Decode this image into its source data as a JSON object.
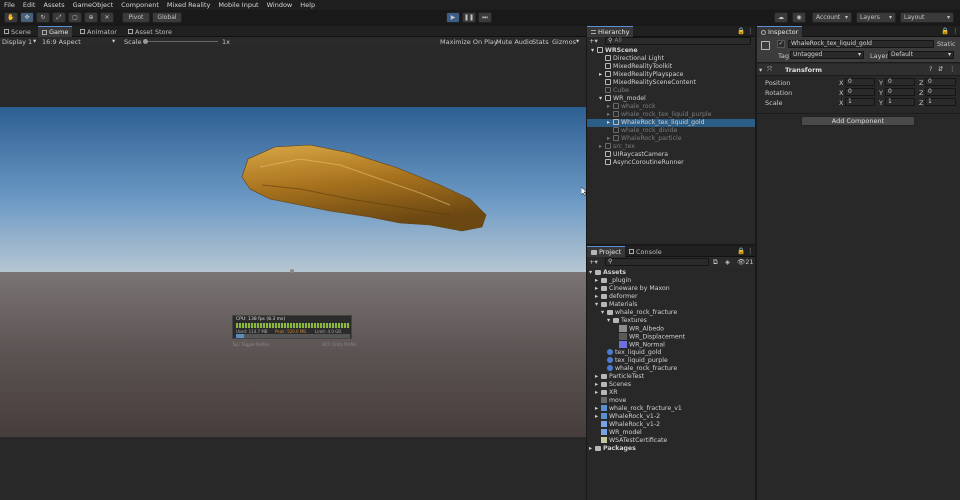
{
  "menu": [
    "File",
    "Edit",
    "Assets",
    "GameObject",
    "Component",
    "Mixed Reality",
    "Mobile Input",
    "Window",
    "Help"
  ],
  "toolbar": {
    "pivot": "Pivot",
    "global": "Global",
    "account": "Account",
    "layers": "Layers",
    "layout": "Layout"
  },
  "scene_tabs": {
    "scene": "Scene",
    "game": "Game",
    "animator": "Animator",
    "asset_store": "Asset Store"
  },
  "game_bar": {
    "display": "Display 1",
    "aspect": "16:9 Aspect",
    "scale_label": "Scale",
    "scale_value": "1x",
    "maximize": "Maximize On Play",
    "mute": "Mute Audio",
    "stats": "Stats",
    "gizmos": "Gizmos"
  },
  "overlay": {
    "cpu": "CPU: 138 fps (8.3 ms)",
    "used": "Used: 114.7 MB",
    "peak": "Peak: 520.0 MB",
    "limit": "Limit: 4.0 GB",
    "line2_left": "Tap: Toggle Profiler",
    "line2_right": "HL5: Unity Profile"
  },
  "hierarchy": {
    "title": "Hierarchy",
    "search": "All",
    "items": [
      {
        "label": "WRScene",
        "depth": 0,
        "dim": false
      },
      {
        "label": "Directional Light",
        "depth": 1,
        "dim": false
      },
      {
        "label": "MixedRealityToolkit",
        "depth": 1,
        "dim": false
      },
      {
        "label": "MixedRealityPlayspace",
        "depth": 1,
        "dim": false
      },
      {
        "label": "MixedRealitySceneContent",
        "depth": 1,
        "dim": false
      },
      {
        "label": "Cube",
        "depth": 1,
        "dim": true
      },
      {
        "label": "WR_model",
        "depth": 1,
        "dim": false
      },
      {
        "label": "whale_rock",
        "depth": 2,
        "dim": true
      },
      {
        "label": "whale_rock_tex_liquid_purple",
        "depth": 2,
        "dim": true
      },
      {
        "label": "WhaleRock_tex_liquid_gold",
        "depth": 2,
        "dim": false
      },
      {
        "label": "whale_rock_divide",
        "depth": 2,
        "dim": true
      },
      {
        "label": "WhaleRock_particle",
        "depth": 2,
        "dim": true
      },
      {
        "label": "src_tex",
        "depth": 1,
        "dim": true
      },
      {
        "label": "UIRaycastCamera",
        "depth": 1,
        "dim": false
      },
      {
        "label": "AsyncCoroutineRunner",
        "depth": 1,
        "dim": false
      }
    ]
  },
  "inspector": {
    "title": "Inspector",
    "object_name": "WhaleRock_tex_liquid_gold",
    "static": "Static",
    "tag_label": "Tag",
    "tag_value": "Untagged",
    "layer_label": "Layer",
    "layer_value": "Default",
    "transform": "Transform",
    "position": {
      "label": "Position",
      "x": "0",
      "y": "0",
      "z": "0"
    },
    "rotation": {
      "label": "Rotation",
      "x": "0",
      "y": "0",
      "z": "0"
    },
    "scale": {
      "label": "Scale",
      "x": "1",
      "y": "1",
      "z": "1"
    },
    "add_component": "Add Component"
  },
  "project": {
    "tab_project": "Project",
    "tab_console": "Console",
    "count": "21",
    "items": [
      {
        "label": "Assets",
        "depth": 0,
        "kind": "folder"
      },
      {
        "label": "_plugin",
        "depth": 1,
        "kind": "folder"
      },
      {
        "label": "Cineware by Maxon",
        "depth": 1,
        "kind": "folder"
      },
      {
        "label": "deformer",
        "depth": 1,
        "kind": "folder"
      },
      {
        "label": "Materials",
        "depth": 1,
        "kind": "folder"
      },
      {
        "label": "whale_rock_fracture",
        "depth": 2,
        "kind": "folder"
      },
      {
        "label": "Textures",
        "depth": 3,
        "kind": "folder"
      },
      {
        "label": "WR_Albedo",
        "depth": 4,
        "kind": "tex_albedo"
      },
      {
        "label": "WR_Displacement",
        "depth": 4,
        "kind": "tex_disp"
      },
      {
        "label": "WR_Normal",
        "depth": 4,
        "kind": "tex_normal"
      },
      {
        "label": "tex_liquid_gold",
        "depth": 2,
        "kind": "mat"
      },
      {
        "label": "tex_liquid_purple",
        "depth": 2,
        "kind": "mat"
      },
      {
        "label": "whale_rock_fracture",
        "depth": 2,
        "kind": "mat"
      },
      {
        "label": "ParticleTest",
        "depth": 1,
        "kind": "folder"
      },
      {
        "label": "Scenes",
        "depth": 1,
        "kind": "folder"
      },
      {
        "label": "XR",
        "depth": 1,
        "kind": "folder"
      },
      {
        "label": "move",
        "depth": 1,
        "kind": "anim"
      },
      {
        "label": "whale_rock_fracture_v1",
        "depth": 1,
        "kind": "model"
      },
      {
        "label": "WhaleRock_v1-2",
        "depth": 1,
        "kind": "model"
      },
      {
        "label": "WhaleRock_v1-2",
        "depth": 1,
        "kind": "prefab"
      },
      {
        "label": "WR_model",
        "depth": 1,
        "kind": "prefab"
      },
      {
        "label": "WSATestCertificate",
        "depth": 1,
        "kind": "cert"
      },
      {
        "label": "Packages",
        "depth": 0,
        "kind": "folder"
      }
    ]
  },
  "colors": {
    "accent": "#3b5d86",
    "selection": "#2c5d87",
    "gold": "#b8862a"
  }
}
